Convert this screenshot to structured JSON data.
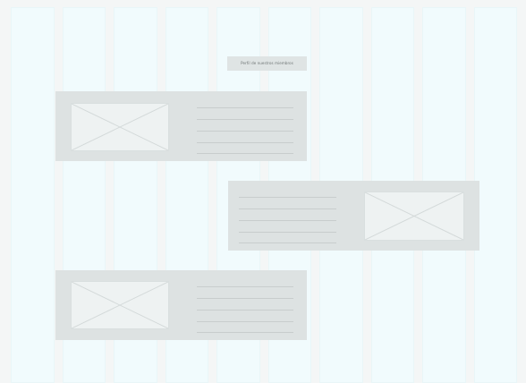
{
  "page": {
    "title": "Perfil de nuestros miembros"
  },
  "colors": {
    "background": "#f4f6f6",
    "grid_column": "#f1fbfd",
    "card": "#dde2e2",
    "image_placeholder": "#eef2f2",
    "text_line": "#c8cdcd"
  },
  "grid": {
    "columns": 10
  },
  "member_cards": [
    {
      "layout": "image-left",
      "text_lines": 5
    },
    {
      "layout": "image-right",
      "text_lines": 5
    },
    {
      "layout": "image-left",
      "text_lines": 5
    }
  ]
}
